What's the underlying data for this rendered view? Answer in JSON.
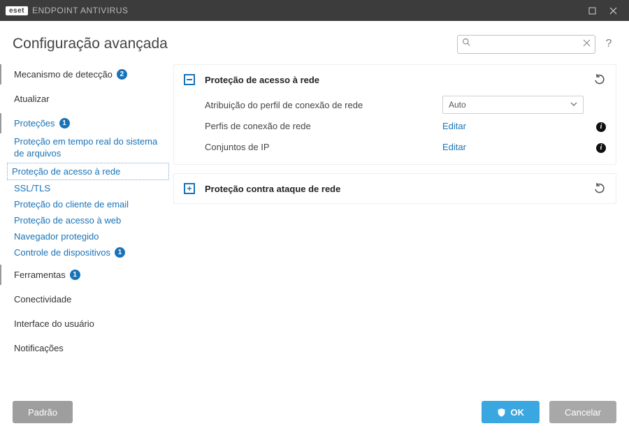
{
  "title_bar": {
    "logo": "eset",
    "brand": "ENDPOINT ANTIVIRUS"
  },
  "header": {
    "title": "Configuração avançada",
    "search_placeholder": "",
    "help": "?"
  },
  "sidebar": {
    "detection": {
      "label": "Mecanismo de detecção",
      "badge": "2"
    },
    "update": {
      "label": "Atualizar"
    },
    "protections": {
      "label": "Proteções",
      "badge": "1"
    },
    "sub_realtime": {
      "label": "Proteção em tempo real do sistema de arquivos"
    },
    "sub_netaccess": {
      "label": "Proteção de acesso à rede"
    },
    "sub_ssl": {
      "label": "SSL/TLS"
    },
    "sub_email": {
      "label": "Proteção do cliente de email"
    },
    "sub_web": {
      "label": "Proteção de acesso à web"
    },
    "sub_browser": {
      "label": "Navegador protegido"
    },
    "sub_device": {
      "label": "Controle de dispositivos",
      "badge": "1"
    },
    "tools": {
      "label": "Ferramentas",
      "badge": "1"
    },
    "connectivity": {
      "label": "Conectividade"
    },
    "ui": {
      "label": "Interface do usuário"
    },
    "notifications": {
      "label": "Notificações"
    }
  },
  "panels": {
    "net_access": {
      "title": "Proteção de acesso à rede",
      "row_profile_assign": "Atribuição do perfil de conexão de rede",
      "select_auto": "Auto",
      "row_profiles": "Perfis de conexão de rede",
      "row_ipsets": "Conjuntos de IP",
      "edit": "Editar"
    },
    "net_attack": {
      "title": "Proteção contra ataque de rede"
    }
  },
  "footer": {
    "default": "Padrão",
    "ok": "OK",
    "cancel": "Cancelar"
  }
}
